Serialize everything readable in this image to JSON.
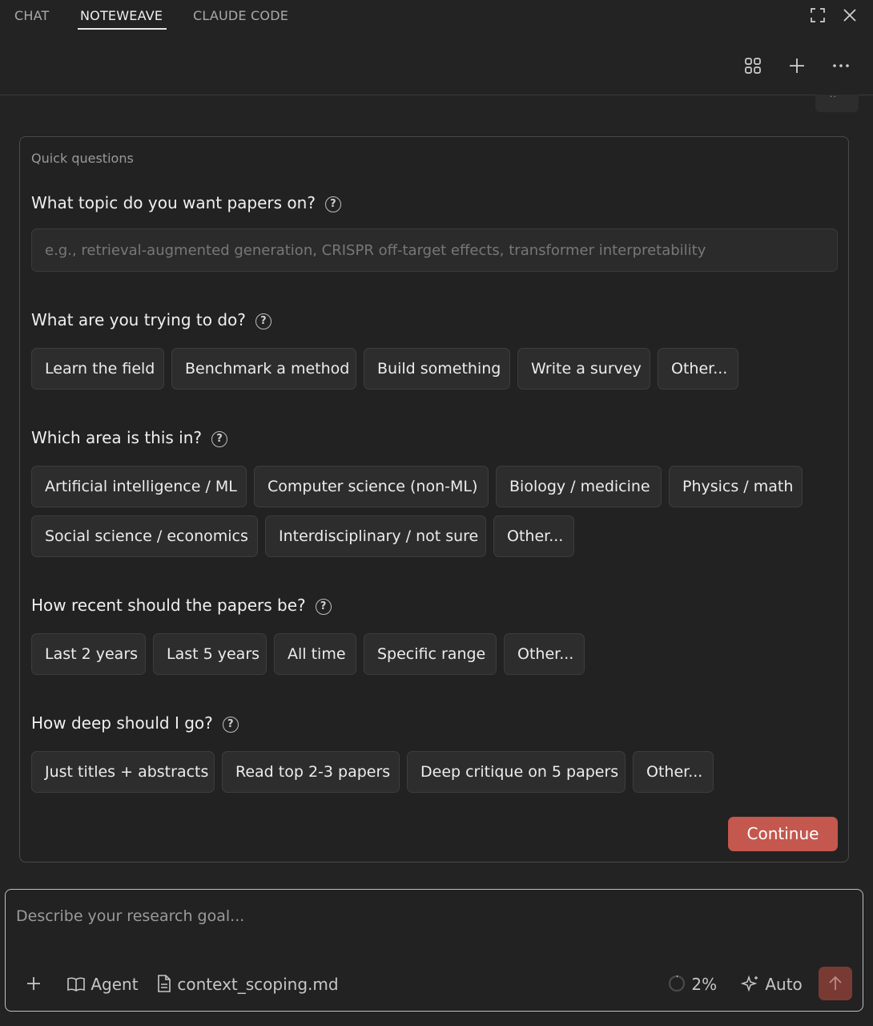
{
  "tabs": [
    {
      "label": "CHAT"
    },
    {
      "label": "NOTEWEAVE"
    },
    {
      "label": "CLAUDE CODE"
    }
  ],
  "active_tab": "NOTEWEAVE",
  "card": {
    "caption": "Quick questions",
    "questions": [
      {
        "title": "What topic do you want papers on?",
        "input_placeholder": "e.g., retrieval-augmented generation, CRISPR off-target effects, transformer interpretability"
      },
      {
        "title": "What are you trying to do?",
        "options": [
          "Learn the field",
          "Benchmark a method",
          "Build something",
          "Write a survey",
          "Other..."
        ]
      },
      {
        "title": "Which area is this in?",
        "options": [
          "Artificial intelligence / ML",
          "Computer science (non-ML)",
          "Biology / medicine",
          "Physics / math",
          "Social science / economics",
          "Interdisciplinary / not sure",
          "Other..."
        ]
      },
      {
        "title": "How recent should the papers be?",
        "options": [
          "Last 2 years",
          "Last 5 years",
          "All time",
          "Specific range",
          "Other..."
        ]
      },
      {
        "title": "How deep should I go?",
        "options": [
          "Just titles + abstracts",
          "Read top 2-3 papers",
          "Deep critique on 5 papers",
          "Other..."
        ]
      }
    ],
    "help_glyph": "?",
    "continue_label": "Continue"
  },
  "composer": {
    "placeholder": "Describe your research goal...",
    "agent_label": "Agent",
    "file_label": "context_scoping.md",
    "progress_label": "2%",
    "progress_fraction": 0.02,
    "mode_label": "Auto"
  },
  "colors": {
    "background": "#232323",
    "accent": "#c4574e",
    "chip_bg": "#2d2d2d",
    "send_disabled": "#7a3a34"
  },
  "icons": {
    "window": [
      "expand-icon",
      "close-icon"
    ],
    "toolbar": [
      "grid-icon",
      "plus-icon",
      "more-icon"
    ],
    "composer": [
      "plus-icon",
      "book-icon",
      "file-icon",
      "progress-ring-icon",
      "sparkle-icon",
      "arrow-up-icon"
    ]
  }
}
